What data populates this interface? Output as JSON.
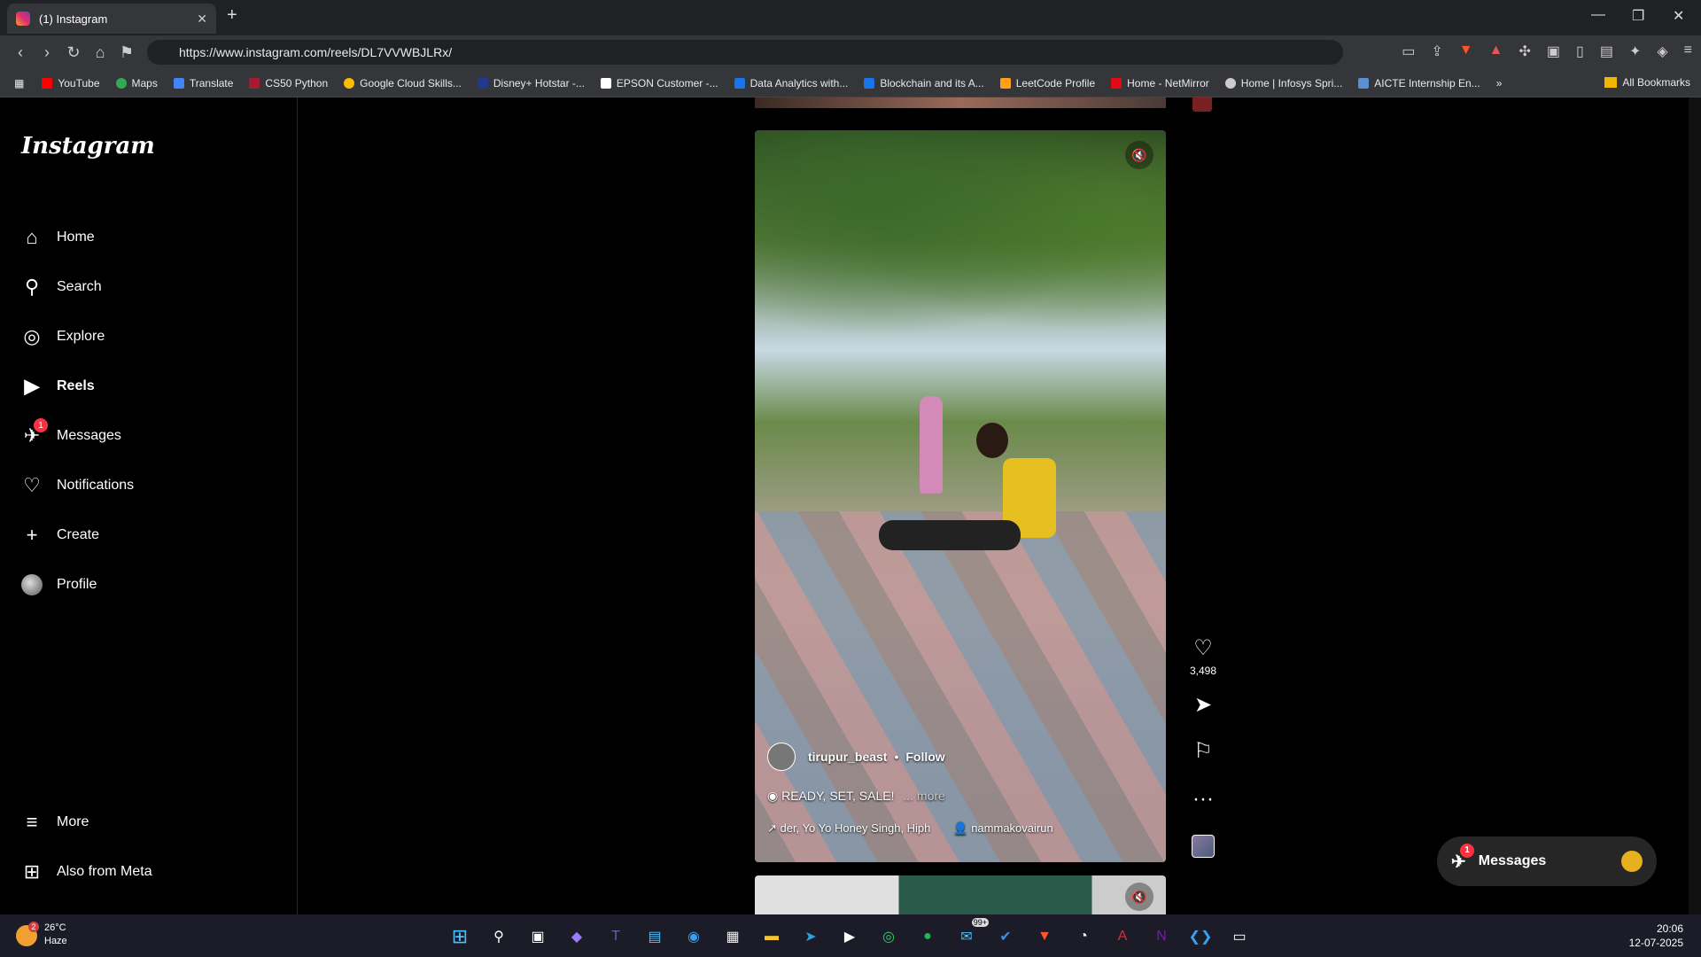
{
  "browser": {
    "tab_title": "(1) Instagram",
    "url": "https://www.instagram.com/reels/DL7VVWBJLRx/",
    "bookmarks": [
      "YouTube",
      "Maps",
      "Translate",
      "CS50 Python",
      "Google Cloud Skills...",
      "Disney+ Hotstar -...",
      "EPSON Customer -...",
      "Data Analytics with...",
      "Blockchain and its A...",
      "LeetCode Profile",
      "Home - NetMirror",
      "Home | Infosys Spri...",
      "AICTE Internship En..."
    ],
    "all_bookmarks": "All Bookmarks"
  },
  "sidebar": {
    "logo": "Instagram",
    "items": [
      {
        "label": "Home",
        "icon": "home-icon"
      },
      {
        "label": "Search",
        "icon": "search-icon"
      },
      {
        "label": "Explore",
        "icon": "compass-icon"
      },
      {
        "label": "Reels",
        "icon": "reels-icon"
      },
      {
        "label": "Messages",
        "icon": "messenger-icon",
        "badge": "1"
      },
      {
        "label": "Notifications",
        "icon": "heart-icon"
      },
      {
        "label": "Create",
        "icon": "plus-icon"
      },
      {
        "label": "Profile",
        "icon": "avatar-icon"
      }
    ],
    "more": "More",
    "also_from_meta": "Also from Meta"
  },
  "reel": {
    "username": "tirupur_beast",
    "follow": "Follow",
    "caption": "READY, SET, SALE!",
    "more": "... more",
    "audio": "der, Yo Yo Honey Singh, Hiph",
    "tagged": "nammakovairun",
    "likes": "3,498"
  },
  "messages_pill": {
    "label": "Messages",
    "badge": "1"
  },
  "taskbar": {
    "temperature": "26°C",
    "condition": "Haze",
    "weather_badge": "2",
    "notif_badge": "99+",
    "time": "20:06",
    "date": "12-07-2025"
  },
  "colors": {
    "badge": "#ff3040",
    "pill_bg": "#262626"
  }
}
